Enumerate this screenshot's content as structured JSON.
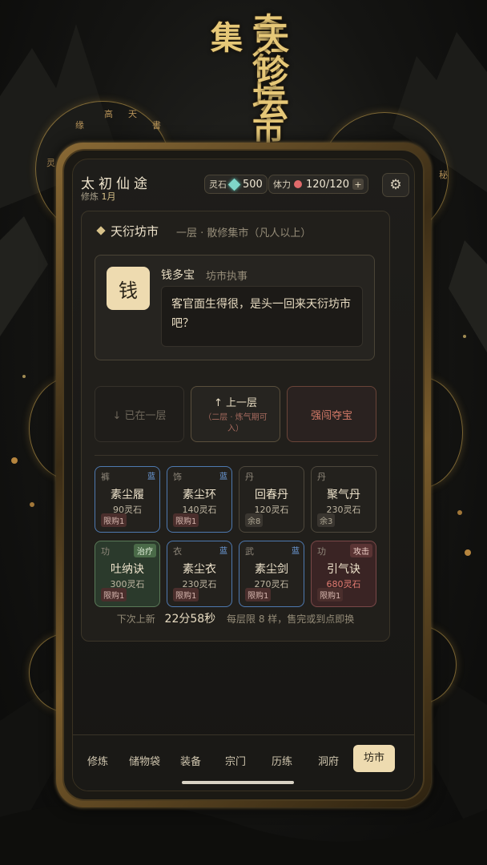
{
  "title": {
    "left": "天珍云集",
    "right": "奇衍坊市"
  },
  "ring_glyphs": [
    "缘",
    "高",
    "天",
    "書",
    "灵",
    "秘"
  ],
  "header": {
    "game_name": "太初仙途",
    "cultivation_label": "修炼",
    "cultivation_value": "1月",
    "spirit_stone_label": "灵石",
    "spirit_stone_value": "500",
    "stamina_label": "体力",
    "stamina_value": "120/120",
    "plus_label": "+"
  },
  "location": {
    "name": "天衍坊市",
    "desc": "一层 · 散修集市（凡人以上）"
  },
  "npc": {
    "avatar_text": "钱",
    "name": "钱多宝",
    "role": "坊市执事",
    "dialog": "客官面生得很，是头一回来天衍坊市吧？"
  },
  "actions": {
    "down": "↓ 已在一层",
    "up": "↑ 上一层",
    "up_sub": "（二层 · 炼气期可入）",
    "rob": "强闯夺宝"
  },
  "items": [
    {
      "cat": "裤",
      "rarity": "蓝",
      "name": "素尘履",
      "price": "90灵石",
      "limit": "限购1",
      "style": "blue"
    },
    {
      "cat": "饰",
      "rarity": "蓝",
      "name": "素尘环",
      "price": "140灵石",
      "limit": "限购1",
      "style": "blue"
    },
    {
      "cat": "丹",
      "rarity": "",
      "name": "回春丹",
      "price": "120灵石",
      "limit": "余8",
      "style": "plain"
    },
    {
      "cat": "丹",
      "rarity": "",
      "name": "聚气丹",
      "price": "230灵石",
      "limit": "余3",
      "style": "plain"
    },
    {
      "cat": "功",
      "tag": "治疗",
      "name": "吐纳诀",
      "price": "300灵石",
      "limit": "限购1",
      "style": "green"
    },
    {
      "cat": "衣",
      "rarity": "蓝",
      "name": "素尘衣",
      "price": "230灵石",
      "limit": "限购1",
      "style": "blue"
    },
    {
      "cat": "武",
      "rarity": "蓝",
      "name": "素尘剑",
      "price": "270灵石",
      "limit": "限购1",
      "style": "blue"
    },
    {
      "cat": "功",
      "tag": "攻击",
      "name": "引气诀",
      "price": "680灵石",
      "limit": "限购1",
      "style": "red"
    }
  ],
  "refresh": {
    "label": "下次上新",
    "time": "22分58秒",
    "note": "每层限 8 样，售完或到点即换"
  },
  "nav": [
    "修炼",
    "储物袋",
    "装备",
    "宗门",
    "历练",
    "洞府",
    "坊市"
  ],
  "colors": {
    "accent_gold": "#eedbb0",
    "rarity_blue": "#4e79b0",
    "heal_green": "#5a7a58",
    "attack_red": "#7a4848"
  }
}
